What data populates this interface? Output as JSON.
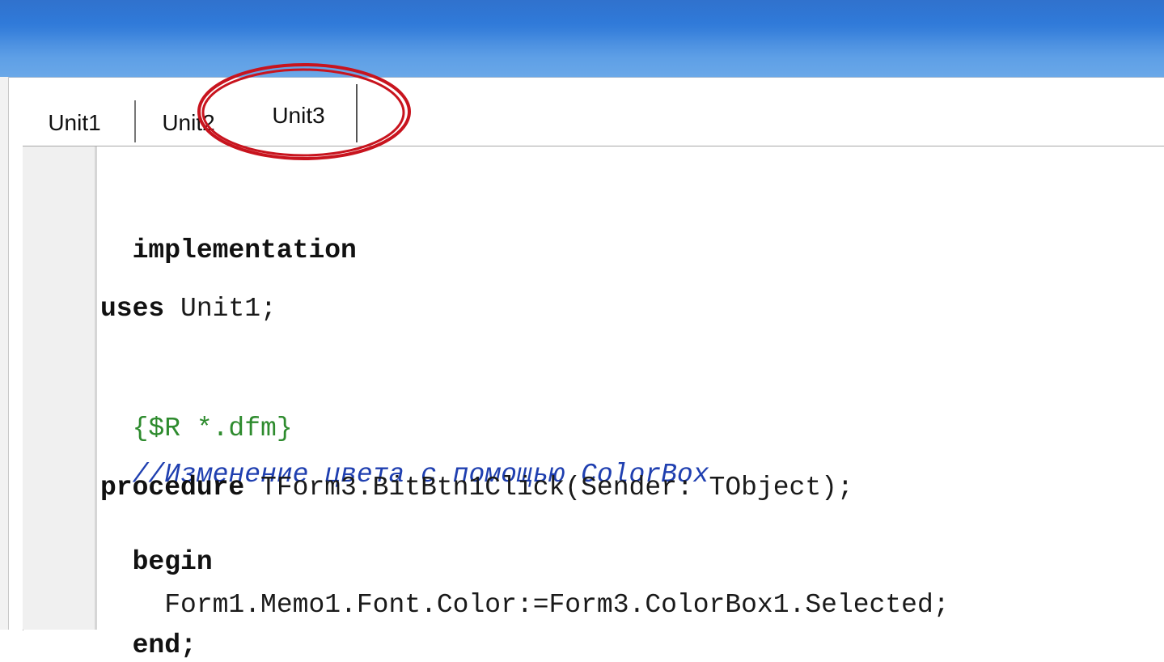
{
  "tabs": [
    {
      "label": "Unit1"
    },
    {
      "label": "Unit2"
    },
    {
      "label": "Unit3"
    }
  ],
  "active_tab": "Unit3",
  "highlight_color": "#c8141e",
  "code": {
    "line_implementation": "implementation",
    "line_uses_kw": "uses",
    "line_uses_rest": " Unit1;",
    "line_directive": "{$R *.dfm}",
    "line_comment": "//Изменение цвета с помощью ColorBox",
    "line_proc_kw": "procedure",
    "line_proc_rest": " TForm3.BitBtn1Click(Sender: TObject);",
    "line_begin": "begin",
    "line_body": "  Form1.Memo1.Font.Color:=Form3.ColorBox1.Selected;",
    "line_end": "end;"
  }
}
